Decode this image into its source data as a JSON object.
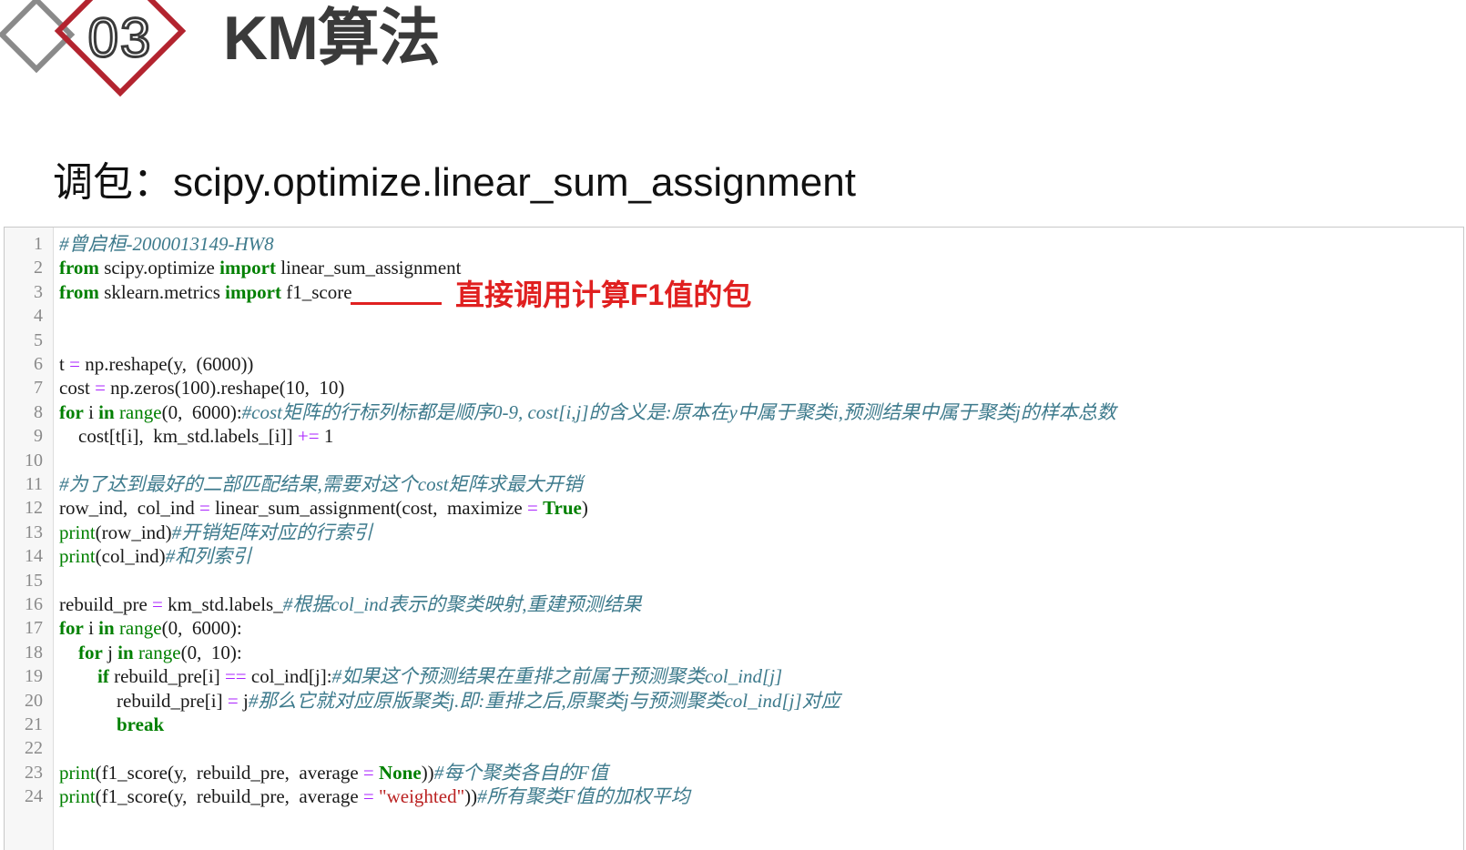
{
  "slide": {
    "number": "03",
    "title": "KM算法",
    "subtitle": "调包：scipy.optimize.linear_sum_assignment",
    "annotation": "直接调用计算F1值的包"
  },
  "colors": {
    "accent": "#b3242f",
    "decoration_grey": "#8a8a8a",
    "annotation": "#e02020"
  },
  "code": {
    "lines": [
      [
        {
          "t": "#曾启桓-2000013149-HW8",
          "c": "cm"
        }
      ],
      [
        {
          "t": "from",
          "c": "kw"
        },
        {
          "t": " scipy.optimize "
        },
        {
          "t": "import",
          "c": "kw"
        },
        {
          "t": " linear_sum_assignment"
        }
      ],
      [
        {
          "t": "from",
          "c": "kw"
        },
        {
          "t": " sklearn.metrics "
        },
        {
          "t": "import",
          "c": "kw"
        },
        {
          "t": " f1_score"
        }
      ],
      [],
      [],
      [
        {
          "t": "t "
        },
        {
          "t": "=",
          "c": "op"
        },
        {
          "t": " np.reshape(y,  (6000))"
        }
      ],
      [
        {
          "t": "cost "
        },
        {
          "t": "=",
          "c": "op"
        },
        {
          "t": " np.zeros(100).reshape(10,  10)"
        }
      ],
      [
        {
          "t": "for",
          "c": "kw"
        },
        {
          "t": " i "
        },
        {
          "t": "in",
          "c": "kw"
        },
        {
          "t": " "
        },
        {
          "t": "range",
          "c": "bi"
        },
        {
          "t": "(0,  6000):"
        },
        {
          "t": "#cost矩阵的行标列标都是顺序0-9, cost[i,j]的含义是:原本在y中属于聚类i,预测结果中属于聚类j的样本总数",
          "c": "cm"
        }
      ],
      [
        {
          "t": "    cost[t[i],  km_std.labels_[i]] "
        },
        {
          "t": "+=",
          "c": "op"
        },
        {
          "t": " 1"
        }
      ],
      [],
      [
        {
          "t": "#为了达到最好的二部匹配结果,需要对这个cost矩阵求最大开销",
          "c": "cm"
        }
      ],
      [
        {
          "t": "row_ind,  col_ind "
        },
        {
          "t": "=",
          "c": "op"
        },
        {
          "t": " linear_sum_assignment(cost,  maximize "
        },
        {
          "t": "=",
          "c": "op"
        },
        {
          "t": " "
        },
        {
          "t": "True",
          "c": "kw"
        },
        {
          "t": ")"
        }
      ],
      [
        {
          "t": "print",
          "c": "bi"
        },
        {
          "t": "(row_ind)"
        },
        {
          "t": "#开销矩阵对应的行索引",
          "c": "cm"
        }
      ],
      [
        {
          "t": "print",
          "c": "bi"
        },
        {
          "t": "(col_ind)"
        },
        {
          "t": "#和列索引",
          "c": "cm"
        }
      ],
      [],
      [
        {
          "t": "rebuild_pre "
        },
        {
          "t": "=",
          "c": "op"
        },
        {
          "t": " km_std.labels_"
        },
        {
          "t": "#根据col_ind表示的聚类映射,重建预测结果",
          "c": "cm"
        }
      ],
      [
        {
          "t": "for",
          "c": "kw"
        },
        {
          "t": " i "
        },
        {
          "t": "in",
          "c": "kw"
        },
        {
          "t": " "
        },
        {
          "t": "range",
          "c": "bi"
        },
        {
          "t": "(0,  6000):"
        }
      ],
      [
        {
          "t": "    "
        },
        {
          "t": "for",
          "c": "kw"
        },
        {
          "t": " j "
        },
        {
          "t": "in",
          "c": "kw"
        },
        {
          "t": " "
        },
        {
          "t": "range",
          "c": "bi"
        },
        {
          "t": "(0,  10):"
        }
      ],
      [
        {
          "t": "        "
        },
        {
          "t": "if",
          "c": "kw"
        },
        {
          "t": " rebuild_pre[i] "
        },
        {
          "t": "==",
          "c": "op"
        },
        {
          "t": " col_ind[j]:"
        },
        {
          "t": "#如果这个预测结果在重排之前属于预测聚类col_ind[j]",
          "c": "cm"
        }
      ],
      [
        {
          "t": "            rebuild_pre[i] "
        },
        {
          "t": "=",
          "c": "op"
        },
        {
          "t": " j"
        },
        {
          "t": "#那么它就对应原版聚类j.即:重排之后,原聚类j与预测聚类col_ind[j]对应",
          "c": "cm"
        }
      ],
      [
        {
          "t": "            "
        },
        {
          "t": "break",
          "c": "kw"
        }
      ],
      [],
      [
        {
          "t": "print",
          "c": "bi"
        },
        {
          "t": "(f1_score(y,  rebuild_pre,  average "
        },
        {
          "t": "=",
          "c": "op"
        },
        {
          "t": " "
        },
        {
          "t": "None",
          "c": "kw"
        },
        {
          "t": "))"
        },
        {
          "t": "#每个聚类各自的F值",
          "c": "cm"
        }
      ],
      [
        {
          "t": "print",
          "c": "bi"
        },
        {
          "t": "(f1_score(y,  rebuild_pre,  average "
        },
        {
          "t": "=",
          "c": "op"
        },
        {
          "t": " "
        },
        {
          "t": "\"weighted\"",
          "c": "str"
        },
        {
          "t": "))"
        },
        {
          "t": "#所有聚类F值的加权平均",
          "c": "cm"
        }
      ]
    ],
    "line_numbers": [
      "1",
      "2",
      "3",
      "4",
      "5",
      "6",
      "7",
      "8",
      "9",
      "10",
      "11",
      "12",
      "13",
      "14",
      "15",
      "16",
      "17",
      "18",
      "19",
      "20",
      "21",
      "22",
      "23",
      "24"
    ]
  }
}
